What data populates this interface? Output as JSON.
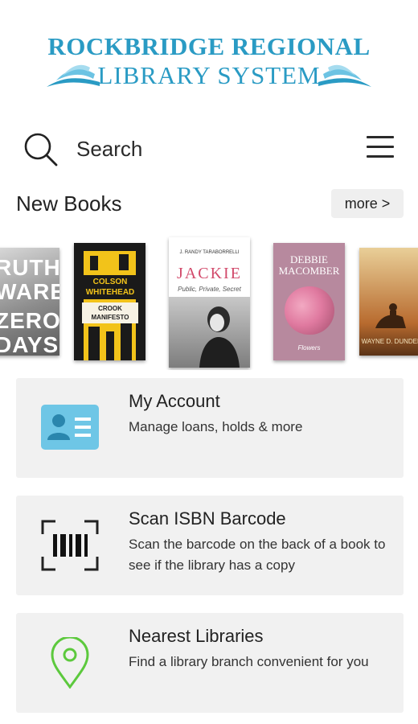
{
  "header": {
    "logo_line1": "ROCKBRIDGE REGIONAL",
    "logo_line2": "LIBRARY SYSTEM",
    "brand_color": "#2a9bc4"
  },
  "search": {
    "label": "Search",
    "icon": "search-icon",
    "menu_icon": "hamburger-menu-icon"
  },
  "new_books": {
    "title": "New Books",
    "more_label": "more >",
    "covers": [
      {
        "author": "RUTH WARE",
        "title": "ZERO DAYS"
      },
      {
        "author": "COLSON WHITEHEAD",
        "title": "CROOK MANIFESTO"
      },
      {
        "author": "J. RANDY TARABORRELLI",
        "title": "JACKIE",
        "subtitle": "Public, Private, Secret"
      },
      {
        "author": "DEBBIE MACOMBER",
        "title": "Flowers"
      },
      {
        "author": "WAYNE D. DUNDEE",
        "title": ""
      }
    ]
  },
  "cards": [
    {
      "title": "My Account",
      "description": "Manage loans, holds & more",
      "icon": "account-card-icon",
      "icon_color": "#5bc0de"
    },
    {
      "title": "Scan ISBN Barcode",
      "description": "Scan the barcode on the back of a book to see if the library has a copy",
      "icon": "barcode-scan-icon"
    },
    {
      "title": "Nearest Libraries",
      "description": "Find a library branch convenient for you",
      "icon": "location-pin-icon",
      "icon_color": "#5cc93d"
    }
  ]
}
